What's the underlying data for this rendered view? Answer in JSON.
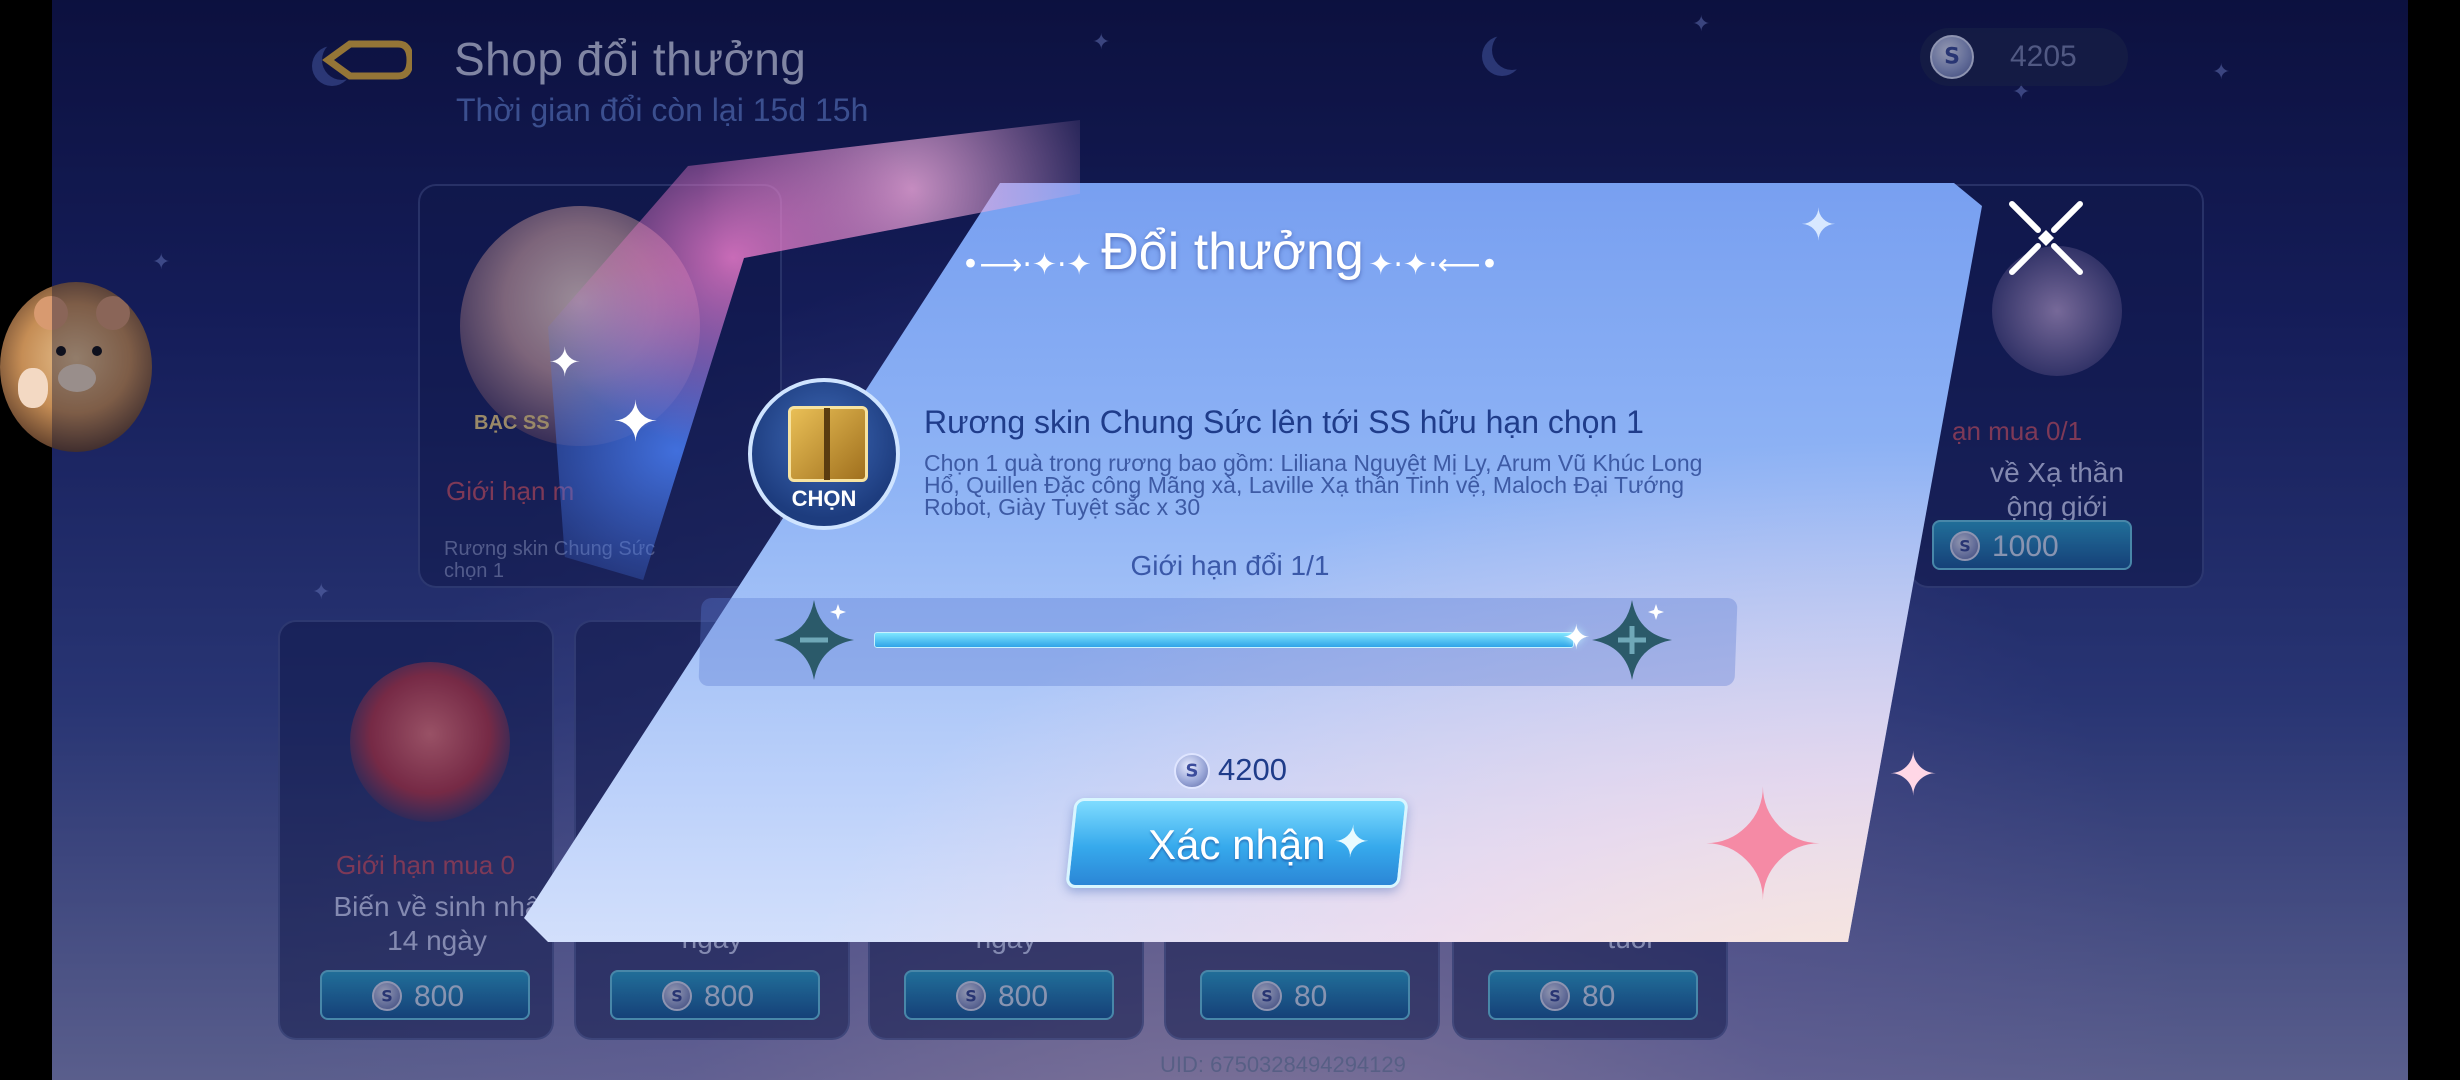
{
  "header": {
    "title": "Shop đổi thưởng",
    "timer": "Thời gian đổi còn lại 15d 15h",
    "currency": "4205"
  },
  "cards": {
    "top_left": {
      "badge": "BẠC SS",
      "limit": "Giới hạn m",
      "desc": "Rương skin Chung Sức\nchọn 1"
    },
    "top_right": {
      "limit": "ạn mua 0/1",
      "title": "về Xạ thần\nộng giới",
      "price": "1000"
    },
    "bottom": [
      {
        "limit": "Giới hạn mua 0",
        "title": "Biến về sinh nhậ\n14 ngày",
        "price": "800"
      },
      {
        "title": "ngày",
        "price": "800"
      },
      {
        "title": "ngày",
        "price": "800"
      },
      {
        "title": "",
        "price": "80"
      },
      {
        "title": "tuổi",
        "price": "80"
      }
    ]
  },
  "uid": "UID: 6750328494294129",
  "modal": {
    "title": "Đổi thưởng",
    "item_icon_label": "CHỌN",
    "item_name": "Rương skin Chung Sức lên tới SS hữu hạn chọn 1",
    "item_desc": "Chọn 1 quà trong rương bao gồm: Liliana Nguyệt Mị Ly, Arum Vũ Khúc Long Hổ, Quillen Đặc công Mãng xà, Laville Xạ thần Tinh vệ, Maloch Đại Tướng Robot, Giày Tuyệt sắc x 30",
    "limit_text": "Giới hạn đổi 1/1",
    "quantity_fraction": 1.0,
    "cost": "4200",
    "confirm_label": "Xác nhận"
  },
  "icons": [
    "back-arrow-icon",
    "clock-icon",
    "coin-icon",
    "close-icon",
    "minus-icon",
    "plus-icon"
  ],
  "colors": {
    "accent": "#36a9ec",
    "modal_text": "#1f3c8a",
    "limit_red": "#c5536e"
  }
}
